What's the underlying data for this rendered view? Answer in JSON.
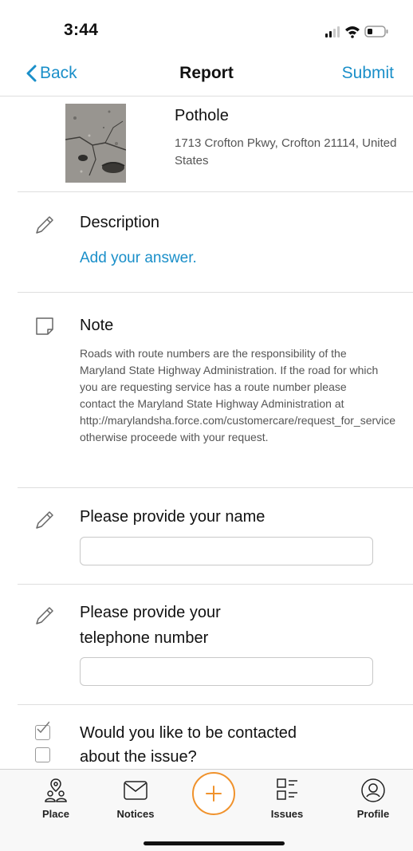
{
  "status_bar": {
    "time": "3:44"
  },
  "nav": {
    "back_label": "Back",
    "title": "Report",
    "submit_label": "Submit"
  },
  "report": {
    "type": "Pothole",
    "address": "1713 Crofton Pkwy, Crofton 21114, United States"
  },
  "description": {
    "title": "Description",
    "answer_link": "Add your answer."
  },
  "note": {
    "title": "Note",
    "text": "Roads with route numbers are the responsibility of the Maryland State Highway Administration.  If the road for which you are requesting service has a route number please contact the Maryland State Highway Administration at http://marylandsha.force.com/customercare/request_for_service  otherwise proceede with your request."
  },
  "name_field": {
    "label": "Please provide your name",
    "value": ""
  },
  "phone_field": {
    "label_line1": "Please provide your",
    "label_line2": "telephone number",
    "value": ""
  },
  "contact_question": {
    "line1": "Would you like to be contacted",
    "line2": "about the issue?"
  },
  "tabbar": {
    "tabs": [
      {
        "label": "Place",
        "icon": "place-icon"
      },
      {
        "label": "Notices",
        "icon": "envelope-icon"
      },
      {
        "label": "Issues",
        "icon": "issues-list-icon"
      },
      {
        "label": "Profile",
        "icon": "profile-icon"
      }
    ],
    "add_icon": "plus-icon"
  },
  "colors": {
    "accent": "#1a8fc9",
    "add_button": "#f0922c"
  }
}
